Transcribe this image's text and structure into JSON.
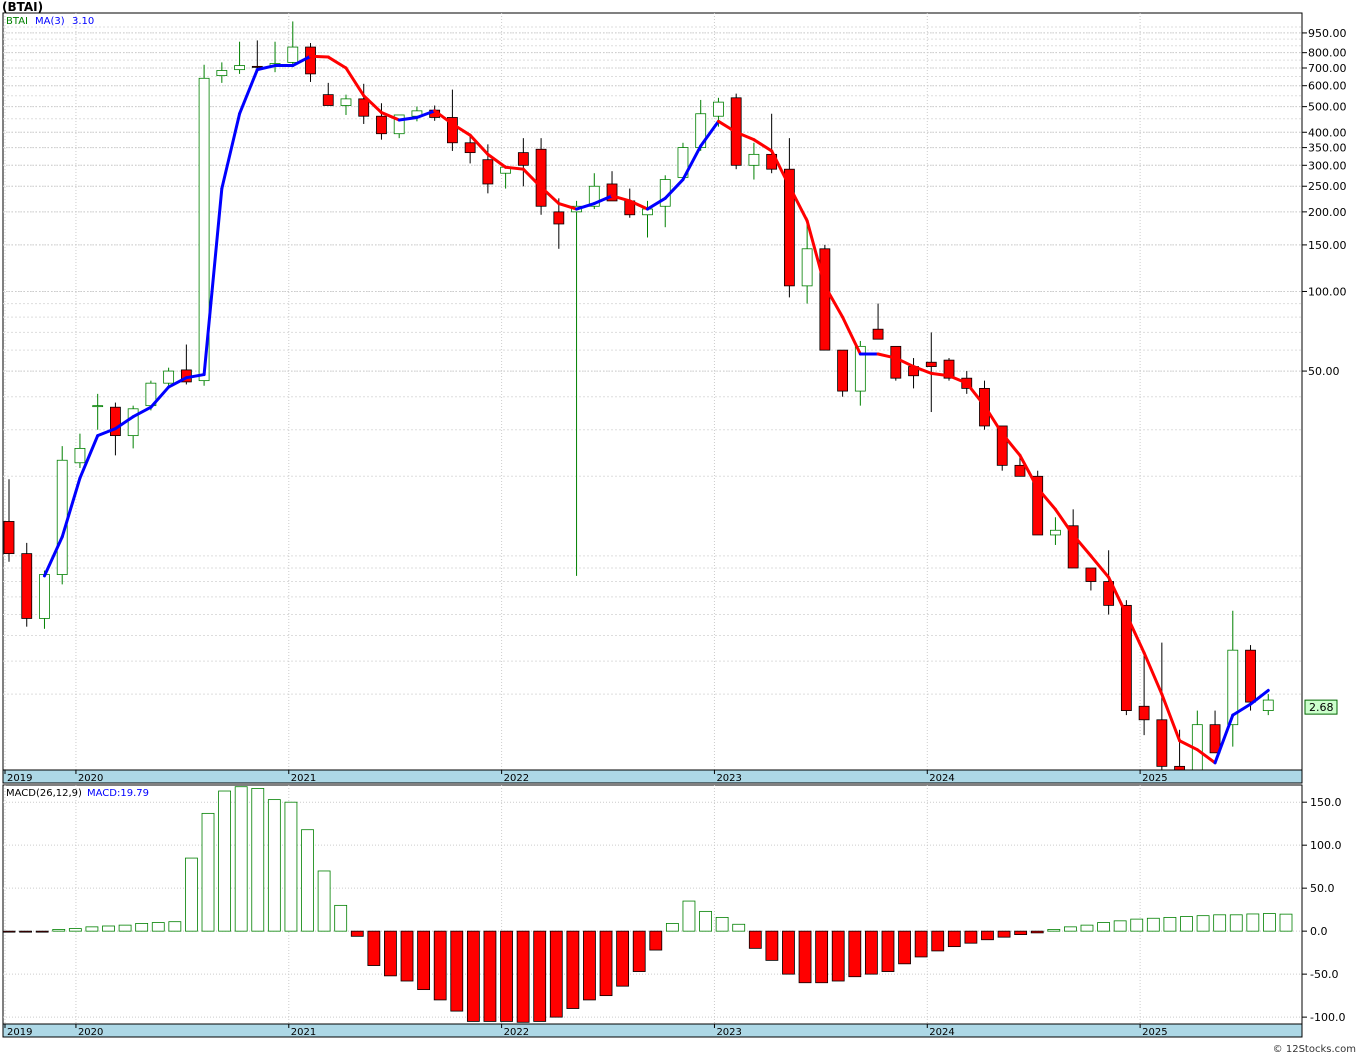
{
  "title": "(BTAI)",
  "credit": "© 12Stocks.com",
  "colors": {
    "up": "#008000",
    "down": "#ff0000",
    "ma_up": "#0000ff",
    "ma_down": "#ff0000",
    "grid": "#cccccc",
    "axis_band": "#add8e6",
    "last_price_bg": "#ccffcc"
  },
  "chart_data": [
    {
      "type": "candlestick",
      "legend": {
        "symbol": "BTAI",
        "ma_label": "MA(3)",
        "ma_value": "3.10"
      },
      "y_scale": "log",
      "ylim": [
        1.55,
        1130
      ],
      "y_ticks": [
        950,
        800,
        700,
        600,
        500,
        400,
        350,
        300,
        250,
        200,
        150,
        100,
        50
      ],
      "y_tick_labels": [
        "950.00",
        "800.00",
        "700.00",
        "600.00",
        "500.00",
        "400.00",
        "350.00",
        "300.00",
        "250.00",
        "200.00",
        "150.00",
        "100.00",
        "50.00"
      ],
      "last_price": "2.68",
      "x_labels": [
        {
          "label": "2019",
          "month": 0
        },
        {
          "label": "2020",
          "month": 4
        },
        {
          "label": "2021",
          "month": 16
        },
        {
          "label": "2022",
          "month": 28
        },
        {
          "label": "2023",
          "month": 40
        },
        {
          "label": "2024",
          "month": 52
        },
        {
          "label": "2025",
          "month": 64
        }
      ],
      "candles": [
        [
          13.5,
          19.5,
          9.5,
          10.2
        ],
        [
          10.2,
          11.2,
          5.4,
          5.8
        ],
        [
          5.8,
          8.8,
          5.3,
          8.5
        ],
        [
          8.5,
          26,
          7.8,
          23
        ],
        [
          22.5,
          29,
          21.5,
          25.5
        ],
        [
          37,
          41,
          30,
          37
        ],
        [
          36.5,
          38,
          24,
          28.5
        ],
        [
          28.5,
          37,
          25.5,
          36
        ],
        [
          37,
          46,
          35.5,
          45
        ],
        [
          45,
          51.5,
          43,
          50
        ],
        [
          50.5,
          63,
          44.5,
          45.5
        ],
        [
          46,
          720,
          44,
          640
        ],
        [
          655,
          735,
          615,
          685
        ],
        [
          690,
          880,
          665,
          715
        ],
        [
          710,
          890,
          675,
          705
        ],
        [
          712,
          880,
          675,
          728
        ],
        [
          735,
          1050,
          705,
          840
        ],
        [
          840,
          870,
          620,
          665
        ],
        [
          555,
          615,
          505,
          505
        ],
        [
          505,
          555,
          465,
          535
        ],
        [
          535,
          610,
          430,
          460
        ],
        [
          460,
          515,
          375,
          395
        ],
        [
          395,
          445,
          380,
          465
        ],
        [
          460,
          500,
          440,
          482
        ],
        [
          485,
          505,
          442,
          455
        ],
        [
          455,
          580,
          340,
          365
        ],
        [
          365,
          385,
          305,
          335
        ],
        [
          315,
          360,
          235,
          255
        ],
        [
          280,
          300,
          245,
          295
        ],
        [
          335,
          380,
          250,
          300
        ],
        [
          345,
          380,
          195,
          210
        ],
        [
          200,
          225,
          145,
          180
        ],
        [
          200,
          220,
          8.4,
          210
        ],
        [
          210,
          280,
          205,
          250
        ],
        [
          255,
          285,
          230,
          220
        ],
        [
          220,
          245,
          190,
          195
        ],
        [
          195,
          220,
          160,
          205
        ],
        [
          210,
          275,
          175,
          265
        ],
        [
          270,
          365,
          265,
          350
        ],
        [
          350,
          530,
          340,
          470
        ],
        [
          460,
          540,
          420,
          520
        ],
        [
          540,
          560,
          290,
          300
        ],
        [
          300,
          365,
          265,
          330
        ],
        [
          330,
          470,
          280,
          290
        ],
        [
          290,
          380,
          95,
          105
        ],
        [
          105,
          190,
          90,
          145
        ],
        [
          145,
          150,
          65,
          60
        ],
        [
          60,
          60,
          40,
          42
        ],
        [
          42,
          65,
          37,
          62
        ],
        [
          72,
          90,
          67,
          66
        ],
        [
          62,
          62,
          46,
          47
        ],
        [
          52,
          56,
          43,
          48
        ],
        [
          54,
          70,
          35,
          52
        ],
        [
          55,
          56,
          46,
          47
        ],
        [
          47,
          50,
          41,
          43
        ],
        [
          43,
          46,
          30,
          31
        ],
        [
          31,
          31,
          21,
          22
        ],
        [
          22,
          24,
          20,
          20
        ],
        [
          20,
          21,
          12,
          12
        ],
        [
          12,
          14,
          11,
          12.5
        ],
        [
          13,
          15,
          10,
          9
        ],
        [
          9,
          9,
          7.4,
          8
        ],
        [
          8,
          10.5,
          6,
          6.5
        ],
        [
          6.5,
          6.8,
          2.5,
          2.6
        ],
        [
          2.7,
          4.2,
          2.1,
          2.4
        ],
        [
          2.4,
          4.7,
          1.55,
          1.6
        ],
        [
          1.6,
          2.2,
          1.55,
          1.55
        ],
        [
          1.55,
          2.6,
          1.55,
          2.3
        ],
        [
          2.3,
          2.6,
          1.8,
          1.8
        ],
        [
          2.3,
          6.2,
          1.9,
          4.4
        ],
        [
          4.4,
          4.6,
          2.6,
          2.8
        ],
        [
          2.6,
          3.0,
          2.5,
          2.85
        ]
      ],
      "ma": [
        null,
        null,
        8.4,
        11.8,
        19.7,
        28.5,
        30.3,
        33.6,
        36.5,
        43.5,
        47.2,
        48.5,
        245,
        470,
        690,
        715,
        715,
        775,
        770,
        700,
        550,
        475,
        445,
        455,
        482,
        430,
        390,
        330,
        295,
        290,
        248,
        215,
        205,
        215,
        230,
        220,
        205,
        225,
        265,
        355,
        440,
        400,
        375,
        340,
        250,
        185,
        105,
        80,
        58,
        58,
        56,
        52,
        49,
        48,
        45,
        37,
        29,
        24,
        18,
        15,
        12,
        10,
        8.3,
        6,
        4.3,
        3.0,
        2.0,
        1.85,
        1.65,
        2.5,
        2.75,
        3.1
      ]
    },
    {
      "type": "bar",
      "legend": {
        "label": "MACD(26,12,9)",
        "value_label": "MACD:19.79"
      },
      "ylim": [
        -108,
        170
      ],
      "y_ticks": [
        150,
        100,
        50,
        0,
        -50,
        -100
      ],
      "y_tick_labels": [
        "150.0",
        "100.0",
        "50.0",
        "0.0",
        "-50.0",
        "-100.0"
      ],
      "x_labels": [
        {
          "label": "2019",
          "month": 0
        },
        {
          "label": "2020",
          "month": 4
        },
        {
          "label": "2021",
          "month": 16
        },
        {
          "label": "2022",
          "month": 28
        },
        {
          "label": "2023",
          "month": 40
        },
        {
          "label": "2024",
          "month": 52
        },
        {
          "label": "2025",
          "month": 64
        }
      ],
      "values": [
        -1,
        -0.5,
        -0.3,
        2,
        3,
        5,
        6,
        7,
        9,
        10,
        11,
        85,
        137,
        163,
        168,
        166,
        153,
        150,
        118,
        70,
        30,
        -6,
        -40,
        -52,
        -58,
        -68,
        -80,
        -93,
        -105,
        -105,
        -105,
        -106,
        -105,
        -100,
        -90,
        -80,
        -75,
        -64,
        -47,
        -22,
        9,
        35,
        23,
        16,
        8,
        -20,
        -34,
        -50,
        -60,
        -60,
        -58,
        -53,
        -50,
        -47,
        -38,
        -30,
        -23,
        -18,
        -14,
        -10,
        -7,
        -4,
        -2,
        2,
        5,
        7,
        10,
        12,
        14,
        15,
        16,
        17,
        18,
        19,
        19,
        20,
        20.5,
        19.79
      ]
    }
  ]
}
